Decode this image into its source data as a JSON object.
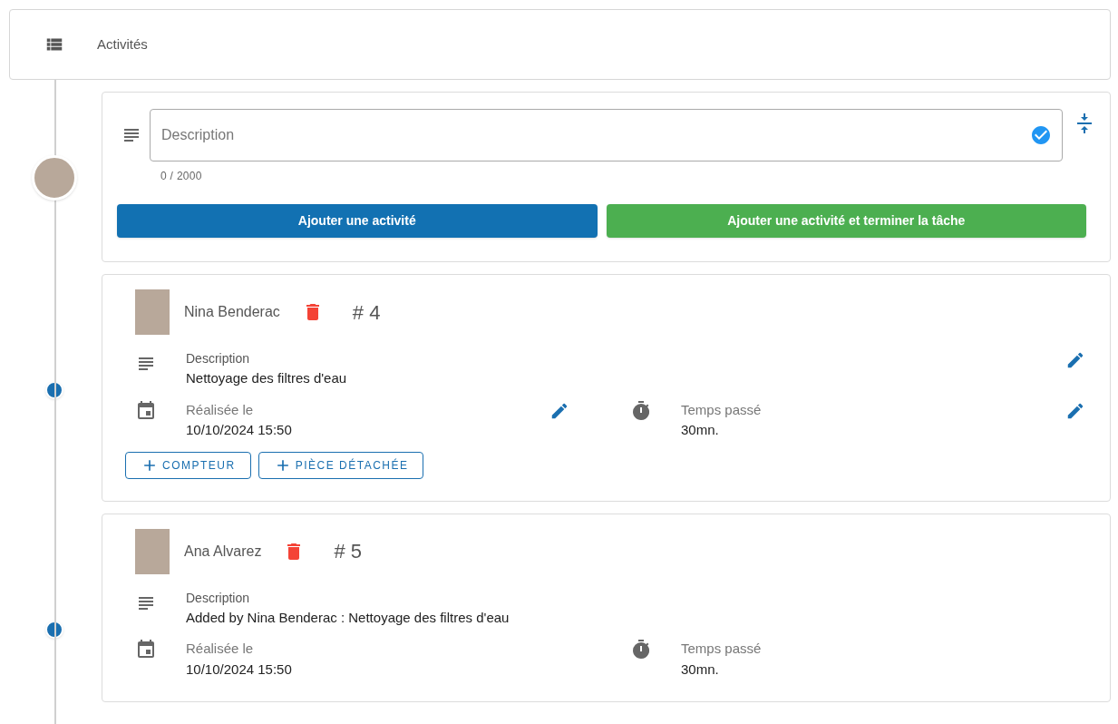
{
  "header": {
    "title": "Activités"
  },
  "composer": {
    "placeholder": "Description",
    "counter": "0 / 2000",
    "valid": true,
    "buttons": [
      {
        "label": "Ajouter une activité",
        "kind": "primary"
      },
      {
        "label": "Ajouter une activité et terminer la tâche",
        "kind": "success"
      }
    ]
  },
  "activities": [
    {
      "author": "Nina Benderac",
      "number": "# 4",
      "editable": true,
      "description_label": "Description",
      "description": "Nettoyage des filtres d'eau",
      "date_label": "Réalisée le",
      "date": "10/10/2024 15:50",
      "time_label": "Temps passé",
      "time": "30mn.",
      "buttons": [
        "COMPTEUR",
        "PIÈCE DÉTACHÉE"
      ]
    },
    {
      "author": "Ana Alvarez",
      "number": "# 5",
      "editable": false,
      "description_label": "Description",
      "description": "Added by Nina Benderac : Nettoyage des filtres d'eau",
      "date_label": "Réalisée le",
      "date": "10/10/2024 15:50",
      "time_label": "Temps passé",
      "time": "30mn."
    }
  ]
}
